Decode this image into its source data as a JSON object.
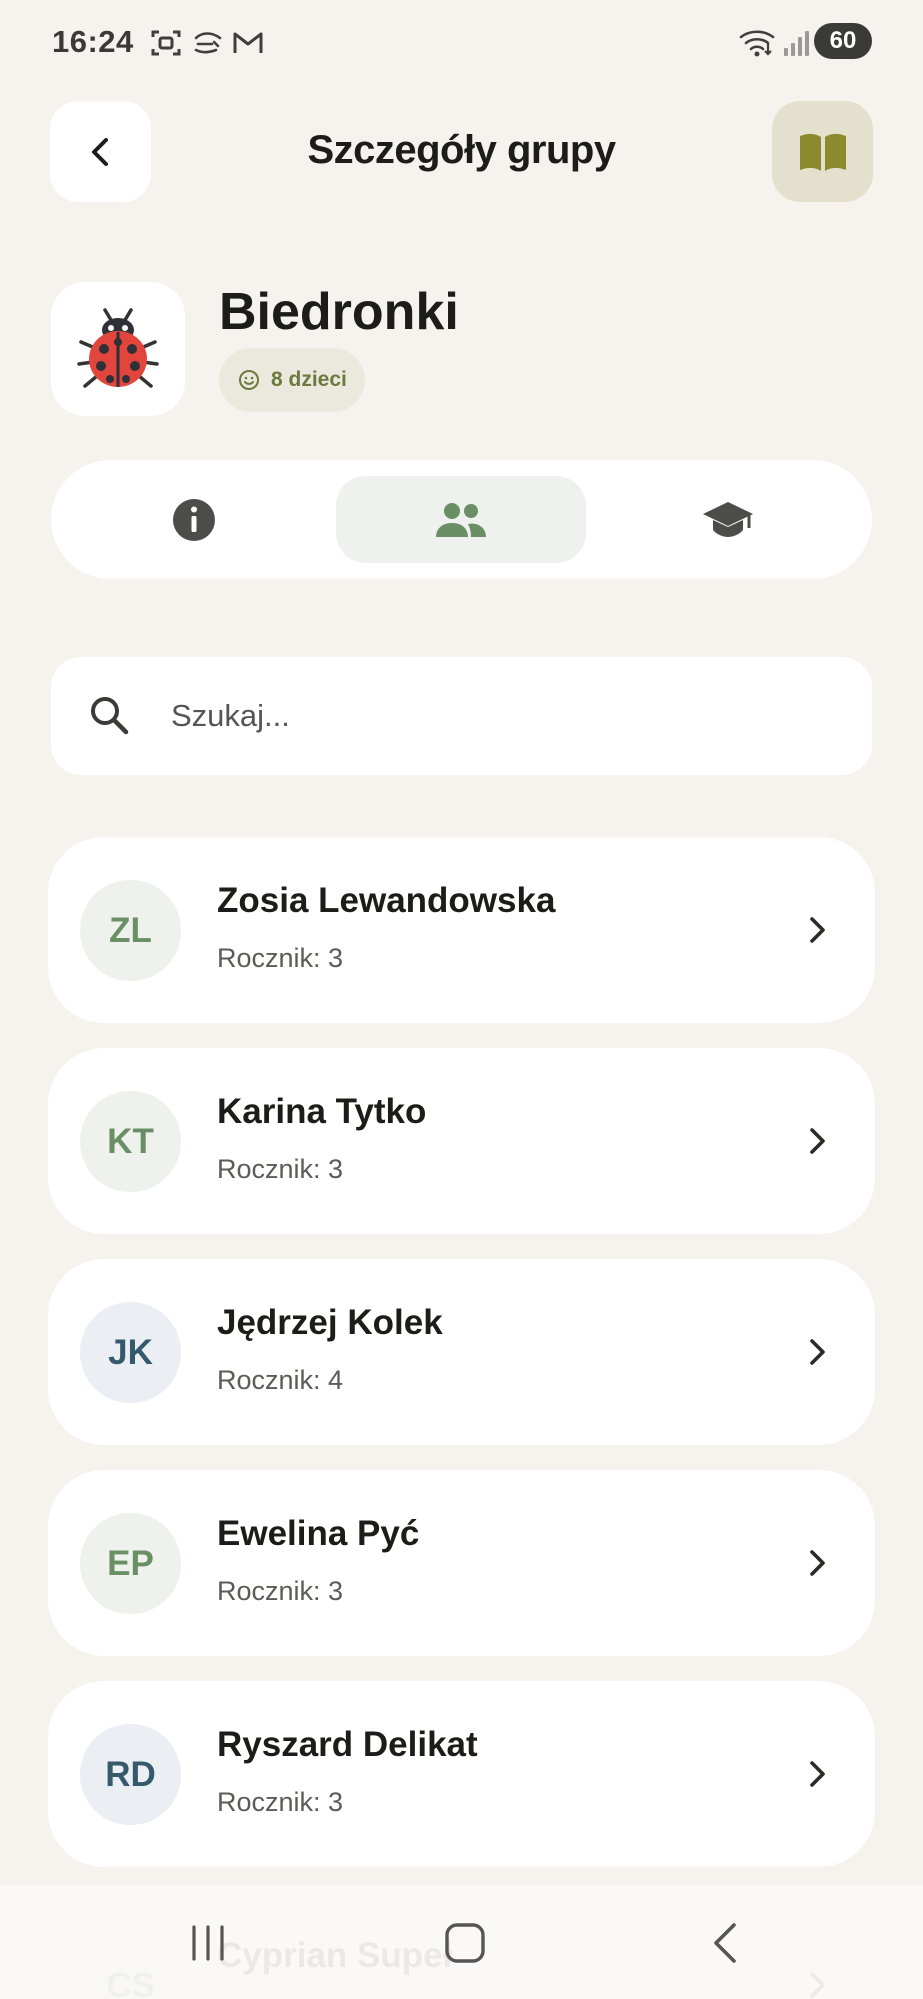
{
  "status_bar": {
    "time": "16:24",
    "battery": "60",
    "left_icons": [
      "screenshot-icon",
      "snow-wind-icon",
      "gmail-icon"
    ],
    "right_icons": [
      "wifi-icon",
      "signal-icon",
      "battery-icon"
    ]
  },
  "header": {
    "title": "Szczegóły grupy",
    "back_icon": "chevron-left-icon",
    "guide_icon": "open-book-icon",
    "accent": "#e3e1cd"
  },
  "group": {
    "emoji": "🐞",
    "name": "Biedronki",
    "kids_badge": "8 dzieci",
    "badge_icon": "smile-icon"
  },
  "tabs": [
    {
      "icon": "info-icon",
      "active": false
    },
    {
      "icon": "people-icon",
      "active": true
    },
    {
      "icon": "graduation-cap-icon",
      "active": false
    }
  ],
  "search": {
    "placeholder": "Szukaj...",
    "value": ""
  },
  "children": [
    {
      "initials": "ZL",
      "name": "Zosia Lewandowska",
      "meta": "Rocznik: 3",
      "color": "green"
    },
    {
      "initials": "KT",
      "name": "Karina Tytko",
      "meta": "Rocznik: 3",
      "color": "green"
    },
    {
      "initials": "JK",
      "name": "Jędrzej Kolek",
      "meta": "Rocznik: 4",
      "color": "blue"
    },
    {
      "initials": "EP",
      "name": "Ewelina Pyć",
      "meta": "Rocznik: 3",
      "color": "green"
    },
    {
      "initials": "RD",
      "name": "Ryszard Delikat",
      "meta": "Rocznik: 3",
      "color": "blue"
    },
    {
      "initials": "CS",
      "name": "Cyprian Supeł",
      "meta": "",
      "color": "green"
    }
  ],
  "colors": {
    "background": "#f6f3ee",
    "card": "#ffffff",
    "avatar_green_text": "#6b8f64",
    "avatar_blue_text": "#355a6c",
    "badge_text": "#6d7a3d"
  },
  "nav": {
    "recent_icon": "recent-apps-icon",
    "home_icon": "home-icon",
    "back_icon": "back-icon"
  }
}
